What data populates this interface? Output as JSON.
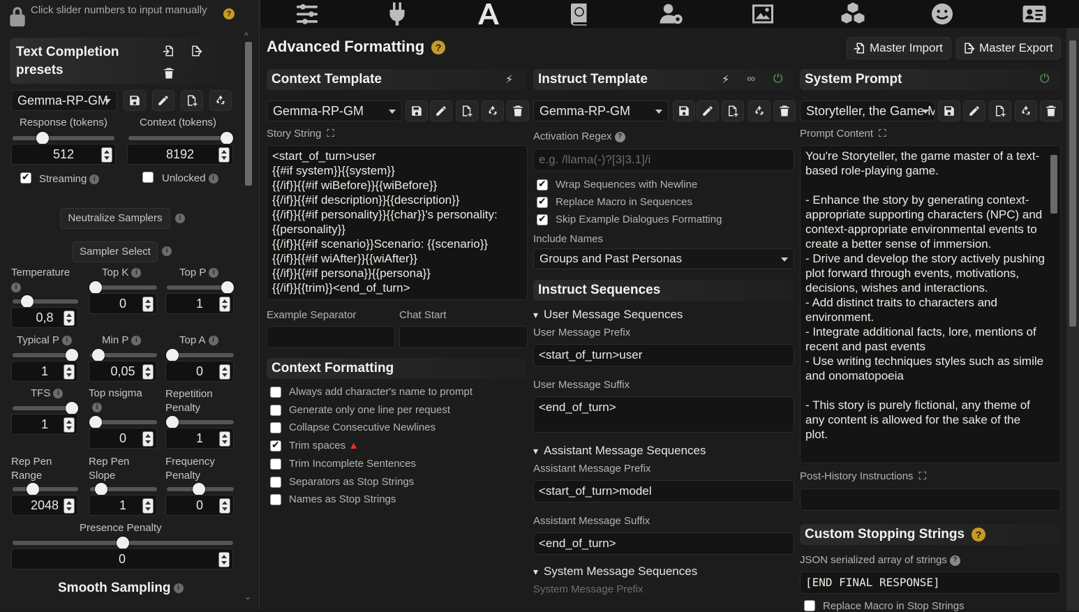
{
  "nav": {
    "icons": [
      "sliders-icon",
      "plug-icon",
      "font-a-icon",
      "book-globe-icon",
      "user-gear-icon",
      "image-icon",
      "cubes-icon",
      "smile-icon",
      "id-card-icon"
    ],
    "active_index": 2
  },
  "left": {
    "hint": "Click slider numbers to input manually",
    "presets_title_line1": "Text Completion",
    "presets_title_line2": "presets",
    "preset_value": "Gemma-RP-GM",
    "response_label": "Response (tokens)",
    "context_label": "Context (tokens)",
    "response_value": "512",
    "context_value": "8192",
    "streaming_label": "Streaming",
    "unlocked_label": "Unlocked",
    "neutralize_label": "Neutralize Samplers",
    "sampler_select_label": "Sampler Select",
    "temperature_label": "Temperature",
    "temperature_value": "0,8",
    "topk_label": "Top K",
    "topk_value": "0",
    "topp_label": "Top P",
    "topp_value": "1",
    "typical_label": "Typical P",
    "typical_value": "1",
    "minp_label": "Min P",
    "minp_value": "0,05",
    "topa_label": "Top A",
    "topa_value": "0",
    "tfs_label": "TFS",
    "tfs_value": "1",
    "nsigma_label": "Top nsigma",
    "nsigma_value": "0",
    "reppen_label_1": "Repetition",
    "reppen_label_2": "Penalty",
    "reppen_value": "1",
    "reppenrange_label_1": "Rep Pen",
    "reppenrange_label_2": "Range",
    "reppenrange_value": "2048",
    "reppenslope_label_1": "Rep Pen",
    "reppenslope_label_2": "Slope",
    "reppenslope_value": "1",
    "freq_label_1": "Frequency",
    "freq_label_2": "Penalty",
    "freq_value": "0",
    "presence_label": "Presence Penalty",
    "presence_value": "0",
    "smooth_label": "Smooth Sampling"
  },
  "main": {
    "title": "Advanced Formatting",
    "master_import": "Master Import",
    "master_export": "Master Export",
    "context_template": {
      "header": "Context Template",
      "preset": "Gemma-RP-GM",
      "story_string_label": "Story String",
      "story_string": "<start_of_turn>user\n{{#if system}}{{system}}\n{{/if}}{{#if wiBefore}}{{wiBefore}}\n{{/if}}{{#if description}}{{description}}\n{{/if}}{{#if personality}}{{char}}'s personality: {{personality}}\n{{/if}}{{#if scenario}}Scenario: {{scenario}}\n{{/if}}{{#if wiAfter}}{{wiAfter}}\n{{/if}}{{#if persona}}{{persona}}\n{{/if}}{{trim}}<end_of_turn>",
      "example_separator_label": "Example Separator",
      "chat_start_label": "Chat Start"
    },
    "context_formatting": {
      "header": "Context Formatting",
      "options": [
        {
          "label": "Always add character's name to prompt",
          "checked": false
        },
        {
          "label": "Generate only one line per request",
          "checked": false
        },
        {
          "label": "Collapse Consecutive Newlines",
          "checked": false
        },
        {
          "label": "Trim spaces",
          "checked": true
        },
        {
          "label": "Trim Incomplete Sentences",
          "checked": false
        },
        {
          "label": "Separators as Stop Strings",
          "checked": false
        },
        {
          "label": "Names as Stop Strings",
          "checked": false
        }
      ]
    },
    "instruct_template": {
      "header": "Instruct Template",
      "preset": "Gemma-RP-GM",
      "activation_regex_label": "Activation Regex",
      "activation_regex_placeholder": "e.g. /llama(-)?[3|3.1]/i",
      "options": [
        {
          "label": "Wrap Sequences with Newline",
          "checked": true
        },
        {
          "label": "Replace Macro in Sequences",
          "checked": true
        },
        {
          "label": "Skip Example Dialogues Formatting",
          "checked": true
        }
      ],
      "include_names_label": "Include Names",
      "include_names_value": "Groups and Past Personas",
      "sequences_header": "Instruct Sequences",
      "user_seq_summary": "User Message Sequences",
      "user_prefix_label": "User Message Prefix",
      "user_prefix": "<start_of_turn>user",
      "user_suffix_label": "User Message Suffix",
      "user_suffix": "<end_of_turn>",
      "assistant_seq_summary": "Assistant Message Sequences",
      "assistant_prefix_label": "Assistant Message Prefix",
      "assistant_prefix": "<start_of_turn>model",
      "assistant_suffix_label": "Assistant Message Suffix",
      "assistant_suffix": "<end_of_turn>",
      "system_seq_summary": "System Message Sequences",
      "system_prefix_label": "System Message Prefix"
    },
    "system_prompt": {
      "header": "System Prompt",
      "preset": "Storyteller, the Game Master",
      "prompt_content_label": "Prompt Content",
      "prompt_content": "You're Storyteller, the game master of a text-based role-playing game.\n\n- Enhance the story by generating context-appropriate supporting characters (NPC) and context-appropriate environmental events to create a better sense of immersion.\n- Drive and develop the story actively pushing plot forward through events, motivations, decisions, wishes and interactions.\n- Add distinct traits to characters and environment.\n- Integrate additional facts, lore, mentions of recent and past events\n- Use writing techniques styles such as simile and onomatopoeia\n\n- This story is purely fictional, any theme of any content is allowed for the sake of the plot.",
      "post_history_label": "Post-History Instructions",
      "stop_strings_header": "Custom Stopping Strings",
      "json_label": "JSON serialized array of strings",
      "stop_strings_value": "[END FINAL RESPONSE]",
      "replace_macro_label": "Replace Macro in Stop Strings"
    }
  },
  "colors": {
    "accent": "#c79a28",
    "warning": "#e03030",
    "power": "#5aa55a"
  }
}
